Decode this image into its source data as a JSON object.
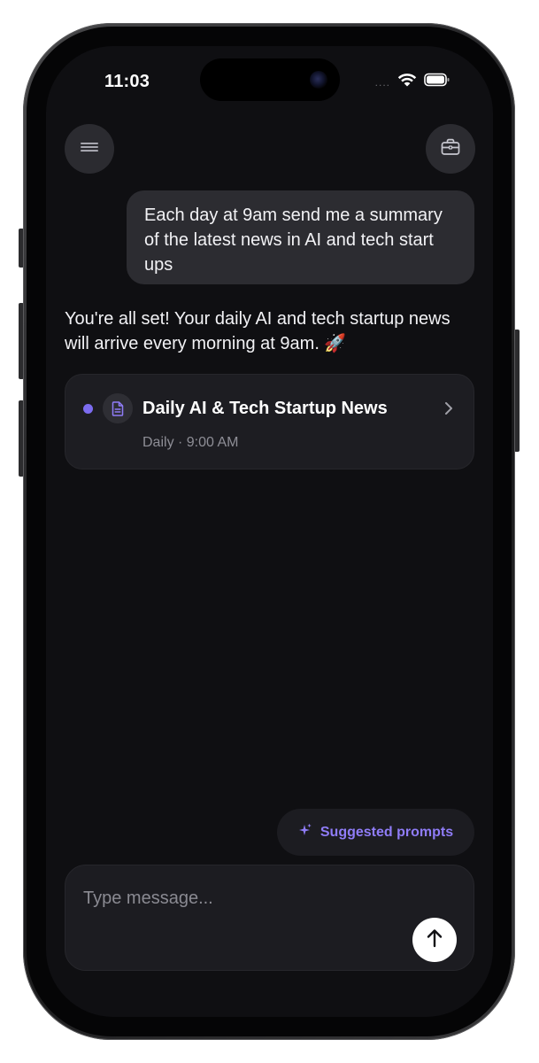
{
  "status_bar": {
    "time": "11:03",
    "signal": "....",
    "wifi_icon": "wifi-icon",
    "battery_icon": "battery-icon"
  },
  "header": {
    "menu_icon": "hamburger-menu-icon",
    "tasks_icon": "briefcase-icon"
  },
  "conversation": {
    "user_message": "Each day at 9am send me a summary of the latest news in AI and tech start ups",
    "assistant_message": "You're all set! Your daily AI and tech startup news will arrive every morning at 9am. 🚀"
  },
  "task_card": {
    "title": "Daily AI & Tech Startup News",
    "schedule": "Daily · 9:00 AM",
    "status_color": "#7c6cf0",
    "icon": "document-icon"
  },
  "suggested_prompts": {
    "label": "Suggested prompts",
    "icon": "sparkle-icon",
    "accent_color": "#8f7cf7"
  },
  "composer": {
    "placeholder": "Type message...",
    "value": "",
    "send_icon": "arrow-up-icon"
  }
}
